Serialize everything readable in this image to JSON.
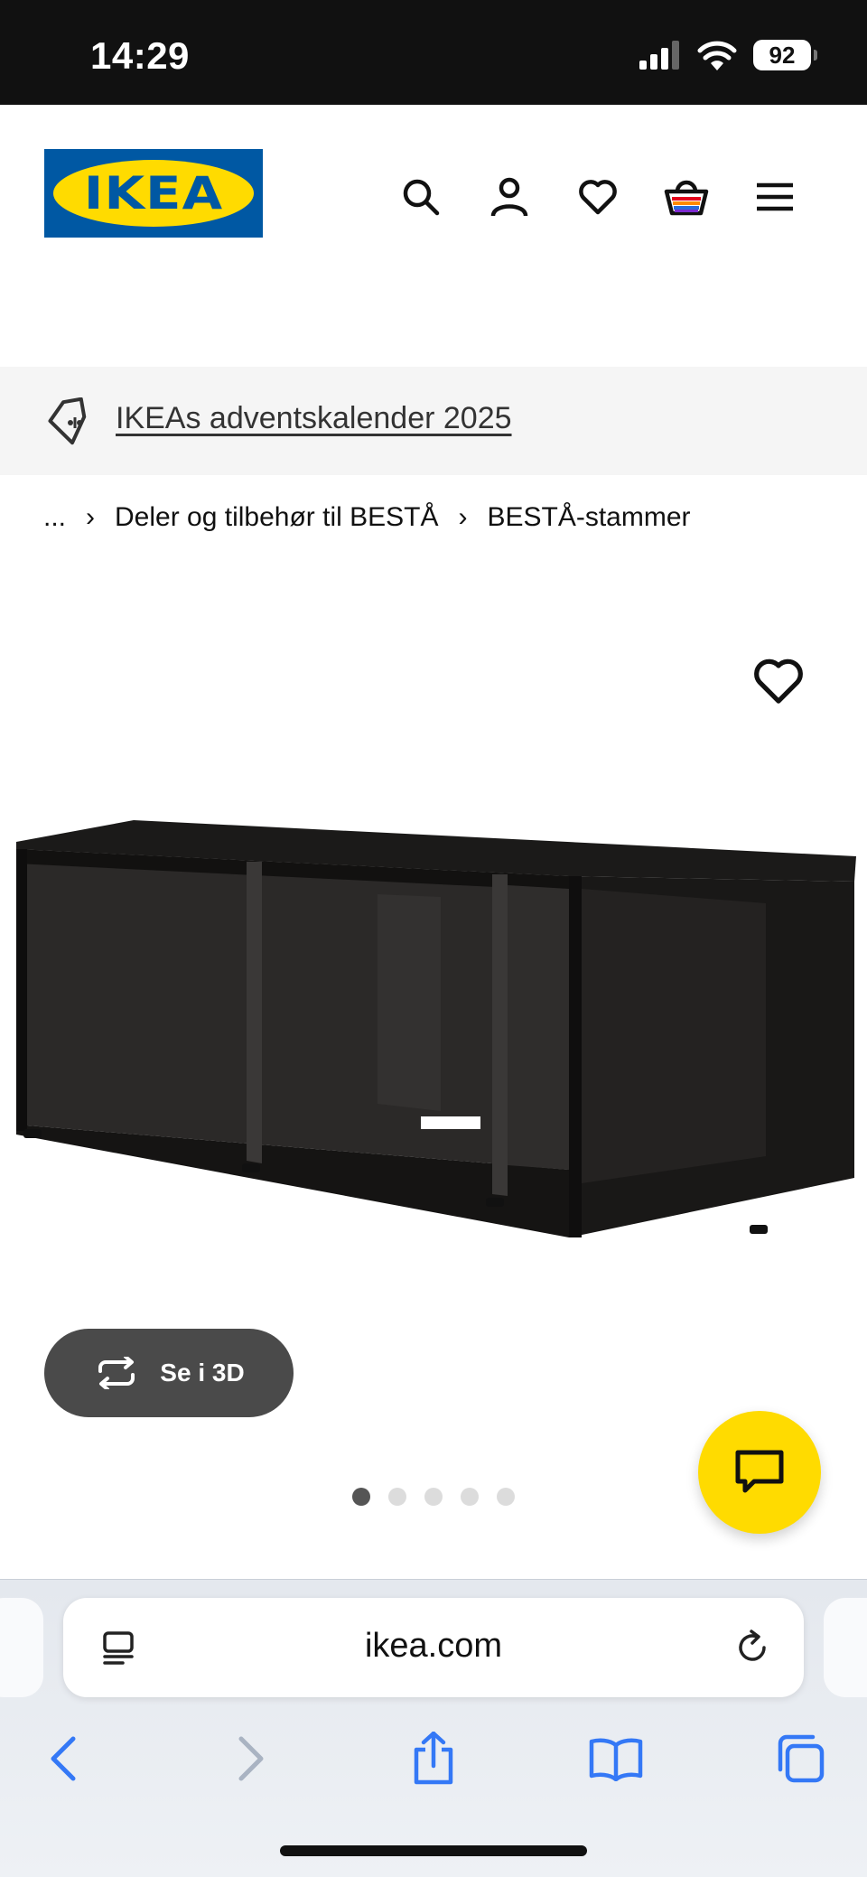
{
  "status_bar": {
    "time": "14:29",
    "battery": "92"
  },
  "header": {
    "logo_text": "IKEA",
    "icons": [
      "search-icon",
      "account-icon",
      "heart-icon",
      "basket-icon",
      "menu-icon"
    ]
  },
  "promo": {
    "link_text": "IKEAs adventskalender 2025",
    "icon": "tag-icon"
  },
  "breadcrumb": {
    "ellipsis": "...",
    "items": [
      "Deler og tilbehør til BESTÅ",
      "BESTÅ-stammer"
    ]
  },
  "product_gallery": {
    "view_3d_label": "Se i 3D",
    "image_count": 5,
    "active_index": 0
  },
  "browser": {
    "url": "ikea.com"
  },
  "colors": {
    "ikea_blue": "#0058a3",
    "ikea_yellow": "#ffdb00",
    "safari_blue": "#3478f6"
  }
}
